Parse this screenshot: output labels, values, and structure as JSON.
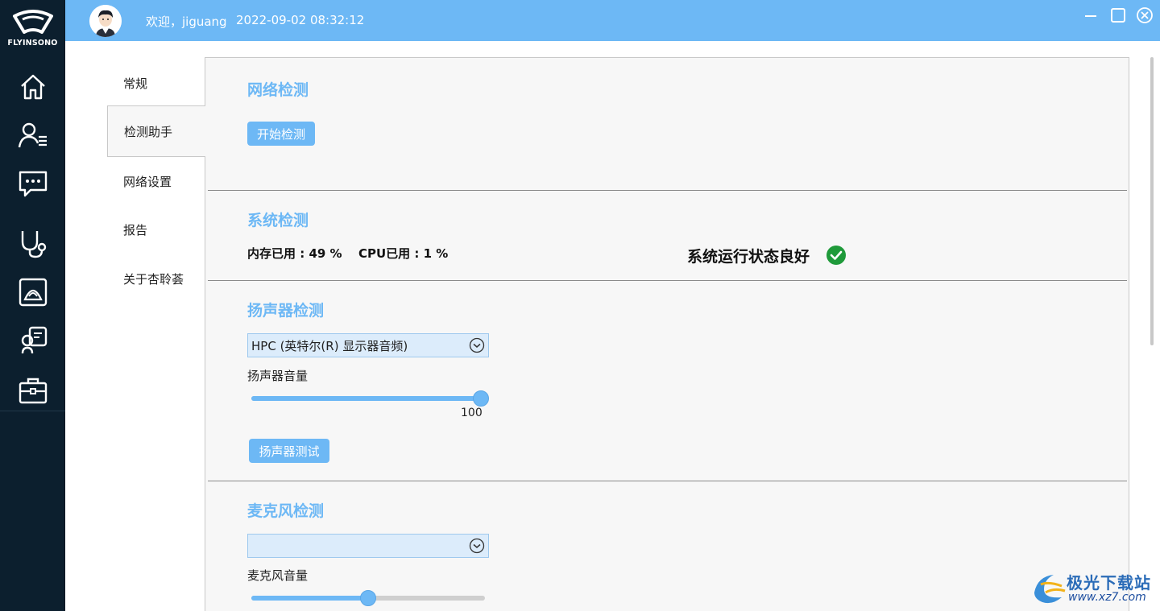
{
  "brand": {
    "name": "FLYINSONO"
  },
  "rail": {
    "icons": [
      "home-icon",
      "user-list-icon",
      "chat-icon",
      "stethoscope-icon",
      "ultrasound-icon",
      "consult-icon",
      "toolbox-icon"
    ]
  },
  "topbar": {
    "welcome": "欢迎，jiguang",
    "datetime": "2022-09-02 08:32:12",
    "bg_color": "#6db8f5"
  },
  "nav": {
    "items": [
      {
        "label": "常规"
      },
      {
        "label": "检测助手"
      },
      {
        "label": "网络设置"
      },
      {
        "label": "报告"
      },
      {
        "label": "关于杏聆荟"
      }
    ],
    "active_index": 1
  },
  "network": {
    "title": "网络检测",
    "start_button": "开始检测"
  },
  "system": {
    "title": "系统检测",
    "memory": "内存已用 : 49 %",
    "cpu": "CPU已用 : 1 %",
    "status": "系统运行状态良好",
    "status_color": "#1f9a3a"
  },
  "speaker": {
    "title": "扬声器检测",
    "device": "HPC (英特尔(R) 显示器音频)",
    "volume_label": "扬声器音量",
    "volume": 100,
    "volume_text": "100",
    "test_button": "扬声器测试"
  },
  "microphone": {
    "title": "麦克风检测",
    "device": "",
    "volume_label": "麦克风音量",
    "volume": 50
  },
  "watermark": {
    "cn": "极光下载站",
    "en": "www.xz7.com"
  }
}
